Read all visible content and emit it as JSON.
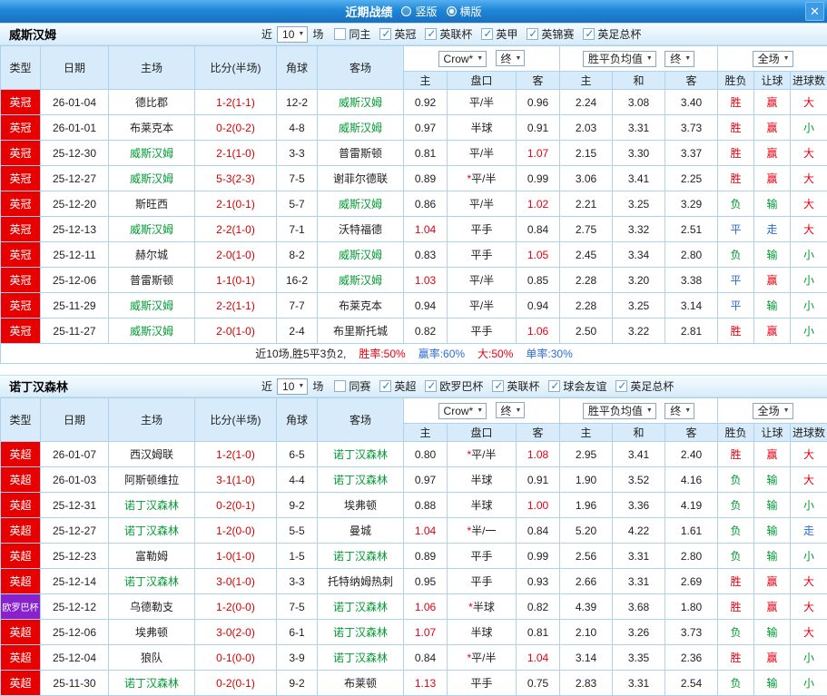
{
  "colors": {
    "accent_blue": "#1e86d6",
    "result_red": "#e60012",
    "result_green": "#009933",
    "result_blue": "#2b6cd4",
    "badge_red": "#e60000",
    "badge_purple": "#8822cc"
  },
  "titlebar": {
    "title": "近期战绩",
    "close": "✕",
    "radios": [
      {
        "label": "竖版",
        "selected": false
      },
      {
        "label": "横版",
        "selected": true
      }
    ]
  },
  "filters": {
    "near_label": "近",
    "count_value": "10",
    "matches_label": "场",
    "odds_company": "Crow*",
    "final_label": "终",
    "avg_label": "胜平负均值",
    "scope_label": "全场"
  },
  "columns": [
    "类型",
    "日期",
    "主场",
    "比分(半场)",
    "角球",
    "客场",
    "主",
    "盘口",
    "客",
    "主",
    "和",
    "客",
    "胜负",
    "让球",
    "进球数"
  ],
  "sections": [
    {
      "team": "威斯汉姆",
      "venue_filter": "同主",
      "leagues": [
        "英冠",
        "英联杯",
        "英甲",
        "英锦赛",
        "英足总杯"
      ],
      "rows": [
        {
          "type": "英冠",
          "type_color": "red",
          "date": "26-01-04",
          "home": "德比郡",
          "score": "1-2(1-1)",
          "corners": "12-2",
          "away": "威斯汉姆",
          "water_home": "0.92",
          "line": "平/半",
          "water_away": "0.96",
          "avg": [
            "2.24",
            "3.08",
            "3.40"
          ],
          "result": "胜",
          "handicap": "赢",
          "goals": "大"
        },
        {
          "type": "英冠",
          "type_color": "red",
          "date": "26-01-01",
          "home": "布莱克本",
          "score": "0-2(0-2)",
          "corners": "4-8",
          "away": "威斯汉姆",
          "water_home": "0.97",
          "line": "半球",
          "water_away": "0.91",
          "avg": [
            "2.03",
            "3.31",
            "3.73"
          ],
          "result": "胜",
          "handicap": "赢",
          "goals": "小"
        },
        {
          "type": "英冠",
          "type_color": "red",
          "date": "25-12-30",
          "home": "威斯汉姆",
          "score": "2-1(1-0)",
          "corners": "3-3",
          "away": "普雷斯顿",
          "water_home": "0.81",
          "line": "平/半",
          "water_away": "1.07",
          "avg": [
            "2.15",
            "3.30",
            "3.37"
          ],
          "result": "胜",
          "handicap": "赢",
          "goals": "大"
        },
        {
          "type": "英冠",
          "type_color": "red",
          "date": "25-12-27",
          "home": "威斯汉姆",
          "score": "5-3(2-3)",
          "corners": "7-5",
          "away": "谢菲尔德联",
          "water_home": "0.89",
          "line": "*平/半",
          "water_away": "0.99",
          "avg": [
            "3.06",
            "3.41",
            "2.25"
          ],
          "result": "胜",
          "handicap": "赢",
          "goals": "大"
        },
        {
          "type": "英冠",
          "type_color": "red",
          "date": "25-12-20",
          "home": "斯旺西",
          "score": "2-1(0-1)",
          "corners": "5-7",
          "away": "威斯汉姆",
          "water_home": "0.86",
          "line": "平/半",
          "water_away": "1.02",
          "avg": [
            "2.21",
            "3.25",
            "3.29"
          ],
          "result": "负",
          "handicap": "输",
          "goals": "大"
        },
        {
          "type": "英冠",
          "type_color": "red",
          "date": "25-12-13",
          "home": "威斯汉姆",
          "score": "2-2(1-0)",
          "corners": "7-1",
          "away": "沃特福德",
          "water_home": "1.04",
          "line": "平手",
          "water_away": "0.84",
          "avg": [
            "2.75",
            "3.32",
            "2.51"
          ],
          "result": "平",
          "handicap": "走",
          "goals": "大"
        },
        {
          "type": "英冠",
          "type_color": "red",
          "date": "25-12-11",
          "home": "赫尔城",
          "score": "2-0(1-0)",
          "corners": "8-2",
          "away": "威斯汉姆",
          "water_home": "0.83",
          "line": "平手",
          "water_away": "1.05",
          "avg": [
            "2.45",
            "3.34",
            "2.80"
          ],
          "result": "负",
          "handicap": "输",
          "goals": "小"
        },
        {
          "type": "英冠",
          "type_color": "red",
          "date": "25-12-06",
          "home": "普雷斯顿",
          "score": "1-1(0-1)",
          "corners": "16-2",
          "away": "威斯汉姆",
          "water_home": "1.03",
          "line": "平/半",
          "water_away": "0.85",
          "avg": [
            "2.28",
            "3.20",
            "3.38"
          ],
          "result": "平",
          "handicap": "赢",
          "goals": "小"
        },
        {
          "type": "英冠",
          "type_color": "red",
          "date": "25-11-29",
          "home": "威斯汉姆",
          "score": "2-2(1-1)",
          "corners": "7-7",
          "away": "布莱克本",
          "water_home": "0.94",
          "line": "平/半",
          "water_away": "0.94",
          "avg": [
            "2.28",
            "3.25",
            "3.14"
          ],
          "result": "平",
          "handicap": "输",
          "goals": "小"
        },
        {
          "type": "英冠",
          "type_color": "red",
          "date": "25-11-27",
          "home": "威斯汉姆",
          "score": "2-0(1-0)",
          "corners": "2-4",
          "away": "布里斯托城",
          "water_home": "0.82",
          "line": "平手",
          "water_away": "1.06",
          "avg": [
            "2.50",
            "3.22",
            "2.81"
          ],
          "result": "胜",
          "handicap": "赢",
          "goals": "小"
        }
      ],
      "summary": {
        "parts": [
          {
            "text": "近10场,胜5平3负2,",
            "color": "dark"
          },
          {
            "text": "胜率:50%",
            "color": "red"
          },
          {
            "text": "赢率:60%",
            "color": "blue"
          },
          {
            "text": "大:50%",
            "color": "red"
          },
          {
            "text": "单率:30%",
            "color": "blue"
          }
        ]
      }
    },
    {
      "team": "诺丁汉森林",
      "venue_filter": "同赛",
      "leagues": [
        "英超",
        "欧罗巴杯",
        "英联杯",
        "球会友谊",
        "英足总杯"
      ],
      "rows": [
        {
          "type": "英超",
          "type_color": "red",
          "date": "26-01-07",
          "home": "西汉姆联",
          "score": "1-2(1-0)",
          "corners": "6-5",
          "away": "诺丁汉森林",
          "water_home": "0.80",
          "line": "*平/半",
          "water_away": "1.08",
          "avg": [
            "2.95",
            "3.41",
            "2.40"
          ],
          "result": "胜",
          "handicap": "赢",
          "goals": "大"
        },
        {
          "type": "英超",
          "type_color": "red",
          "date": "26-01-03",
          "home": "阿斯顿维拉",
          "score": "3-1(1-0)",
          "corners": "4-4",
          "away": "诺丁汉森林",
          "water_home": "0.97",
          "line": "半球",
          "water_away": "0.91",
          "avg": [
            "1.90",
            "3.52",
            "4.16"
          ],
          "result": "负",
          "handicap": "输",
          "goals": "大"
        },
        {
          "type": "英超",
          "type_color": "red",
          "date": "25-12-31",
          "home": "诺丁汉森林",
          "score": "0-2(0-1)",
          "corners": "9-2",
          "away": "埃弗顿",
          "water_home": "0.88",
          "line": "半球",
          "water_away": "1.00",
          "avg": [
            "1.96",
            "3.36",
            "4.19"
          ],
          "result": "负",
          "handicap": "输",
          "goals": "小"
        },
        {
          "type": "英超",
          "type_color": "red",
          "date": "25-12-27",
          "home": "诺丁汉森林",
          "score": "1-2(0-0)",
          "corners": "5-5",
          "away": "曼城",
          "water_home": "1.04",
          "line": "*半/一",
          "water_away": "0.84",
          "avg": [
            "5.20",
            "4.22",
            "1.61"
          ],
          "result": "负",
          "handicap": "输",
          "goals": "走"
        },
        {
          "type": "英超",
          "type_color": "red",
          "date": "25-12-23",
          "home": "富勒姆",
          "score": "1-0(1-0)",
          "corners": "1-5",
          "away": "诺丁汉森林",
          "water_home": "0.89",
          "line": "平手",
          "water_away": "0.99",
          "avg": [
            "2.56",
            "3.31",
            "2.80"
          ],
          "result": "负",
          "handicap": "输",
          "goals": "小"
        },
        {
          "type": "英超",
          "type_color": "red",
          "date": "25-12-14",
          "home": "诺丁汉森林",
          "score": "3-0(1-0)",
          "corners": "3-3",
          "away": "托特纳姆热刺",
          "water_home": "0.95",
          "line": "平手",
          "water_away": "0.93",
          "avg": [
            "2.66",
            "3.31",
            "2.69"
          ],
          "result": "胜",
          "handicap": "赢",
          "goals": "大"
        },
        {
          "type": "欧罗巴杯",
          "type_color": "purple",
          "date": "25-12-12",
          "home": "乌德勒支",
          "score": "1-2(0-0)",
          "corners": "7-5",
          "away": "诺丁汉森林",
          "water_home": "1.06",
          "line": "*半球",
          "water_away": "0.82",
          "avg": [
            "4.39",
            "3.68",
            "1.80"
          ],
          "result": "胜",
          "handicap": "赢",
          "goals": "大"
        },
        {
          "type": "英超",
          "type_color": "red",
          "date": "25-12-06",
          "home": "埃弗顿",
          "score": "3-0(2-0)",
          "corners": "6-1",
          "away": "诺丁汉森林",
          "water_home": "1.07",
          "line": "半球",
          "water_away": "0.81",
          "avg": [
            "2.10",
            "3.26",
            "3.73"
          ],
          "result": "负",
          "handicap": "输",
          "goals": "大"
        },
        {
          "type": "英超",
          "type_color": "red",
          "date": "25-12-04",
          "home": "狼队",
          "score": "0-1(0-0)",
          "corners": "3-9",
          "away": "诺丁汉森林",
          "water_home": "0.84",
          "line": "*平/半",
          "water_away": "1.04",
          "avg": [
            "3.14",
            "3.35",
            "2.36"
          ],
          "result": "胜",
          "handicap": "赢",
          "goals": "小"
        },
        {
          "type": "英超",
          "type_color": "red",
          "date": "25-11-30",
          "home": "诺丁汉森林",
          "score": "0-2(0-1)",
          "corners": "9-2",
          "away": "布莱顿",
          "water_home": "1.13",
          "line": "平手",
          "water_away": "0.75",
          "avg": [
            "2.83",
            "3.31",
            "2.54"
          ],
          "result": "负",
          "handicap": "输",
          "goals": "小"
        }
      ]
    }
  ]
}
